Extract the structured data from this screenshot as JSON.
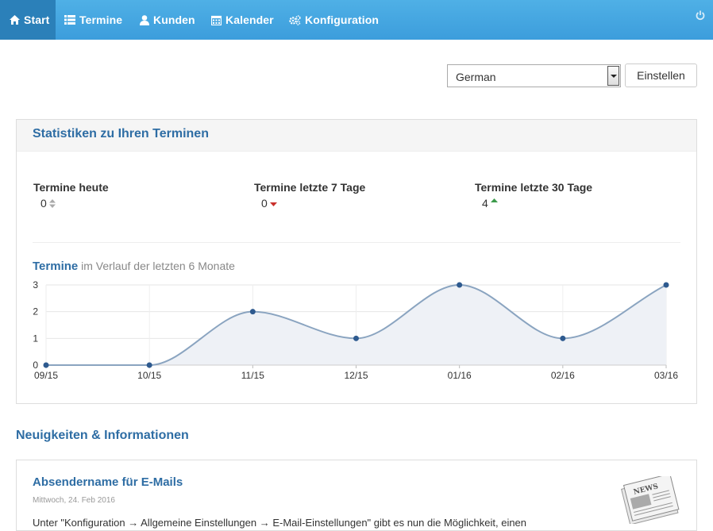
{
  "nav": {
    "items": [
      {
        "label": "Start",
        "icon": "home-icon",
        "active": true
      },
      {
        "label": "Termine",
        "icon": "list-icon"
      },
      {
        "label": "Kunden",
        "icon": "user-icon"
      },
      {
        "label": "Kalender",
        "icon": "calendar-icon"
      },
      {
        "label": "Konfiguration",
        "icon": "cogs-icon"
      }
    ],
    "power_icon": "power-icon"
  },
  "language": {
    "selected": "German",
    "button": "Einstellen"
  },
  "stats": {
    "title": "Statistiken zu Ihren Terminen",
    "items": [
      {
        "label": "Termine heute",
        "value": "0",
        "trend": "neutral"
      },
      {
        "label": "Termine letzte 7 Tage",
        "value": "0",
        "trend": "down"
      },
      {
        "label": "Termine letzte 30 Tage",
        "value": "4",
        "trend": "up"
      }
    ],
    "chart_title_bold": "Termine",
    "chart_title_rest": " im Verlauf der letzten 6 Monate"
  },
  "chart_data": {
    "type": "area",
    "categories": [
      "09/15",
      "10/15",
      "11/15",
      "12/15",
      "01/16",
      "02/16",
      "03/16"
    ],
    "values": [
      0,
      0,
      2,
      1,
      3,
      1,
      3
    ],
    "ylim": [
      0,
      3
    ],
    "yticks": [
      0,
      1,
      2,
      3
    ],
    "grid": true,
    "colors": {
      "line": "#8aa4c0",
      "fill": "#eef1f6",
      "point": "#2e5a8f"
    }
  },
  "news": {
    "heading": "Neuigkeiten & Informationen",
    "items": [
      {
        "title": "Absendername für E-Mails",
        "date": "Mittwoch, 24. Feb 2016",
        "text": "Unter \"Konfiguration → Allgemeine Einstellungen → E-Mail-Einstellungen\" gibt es nun die Möglichkeit, einen"
      }
    ]
  }
}
